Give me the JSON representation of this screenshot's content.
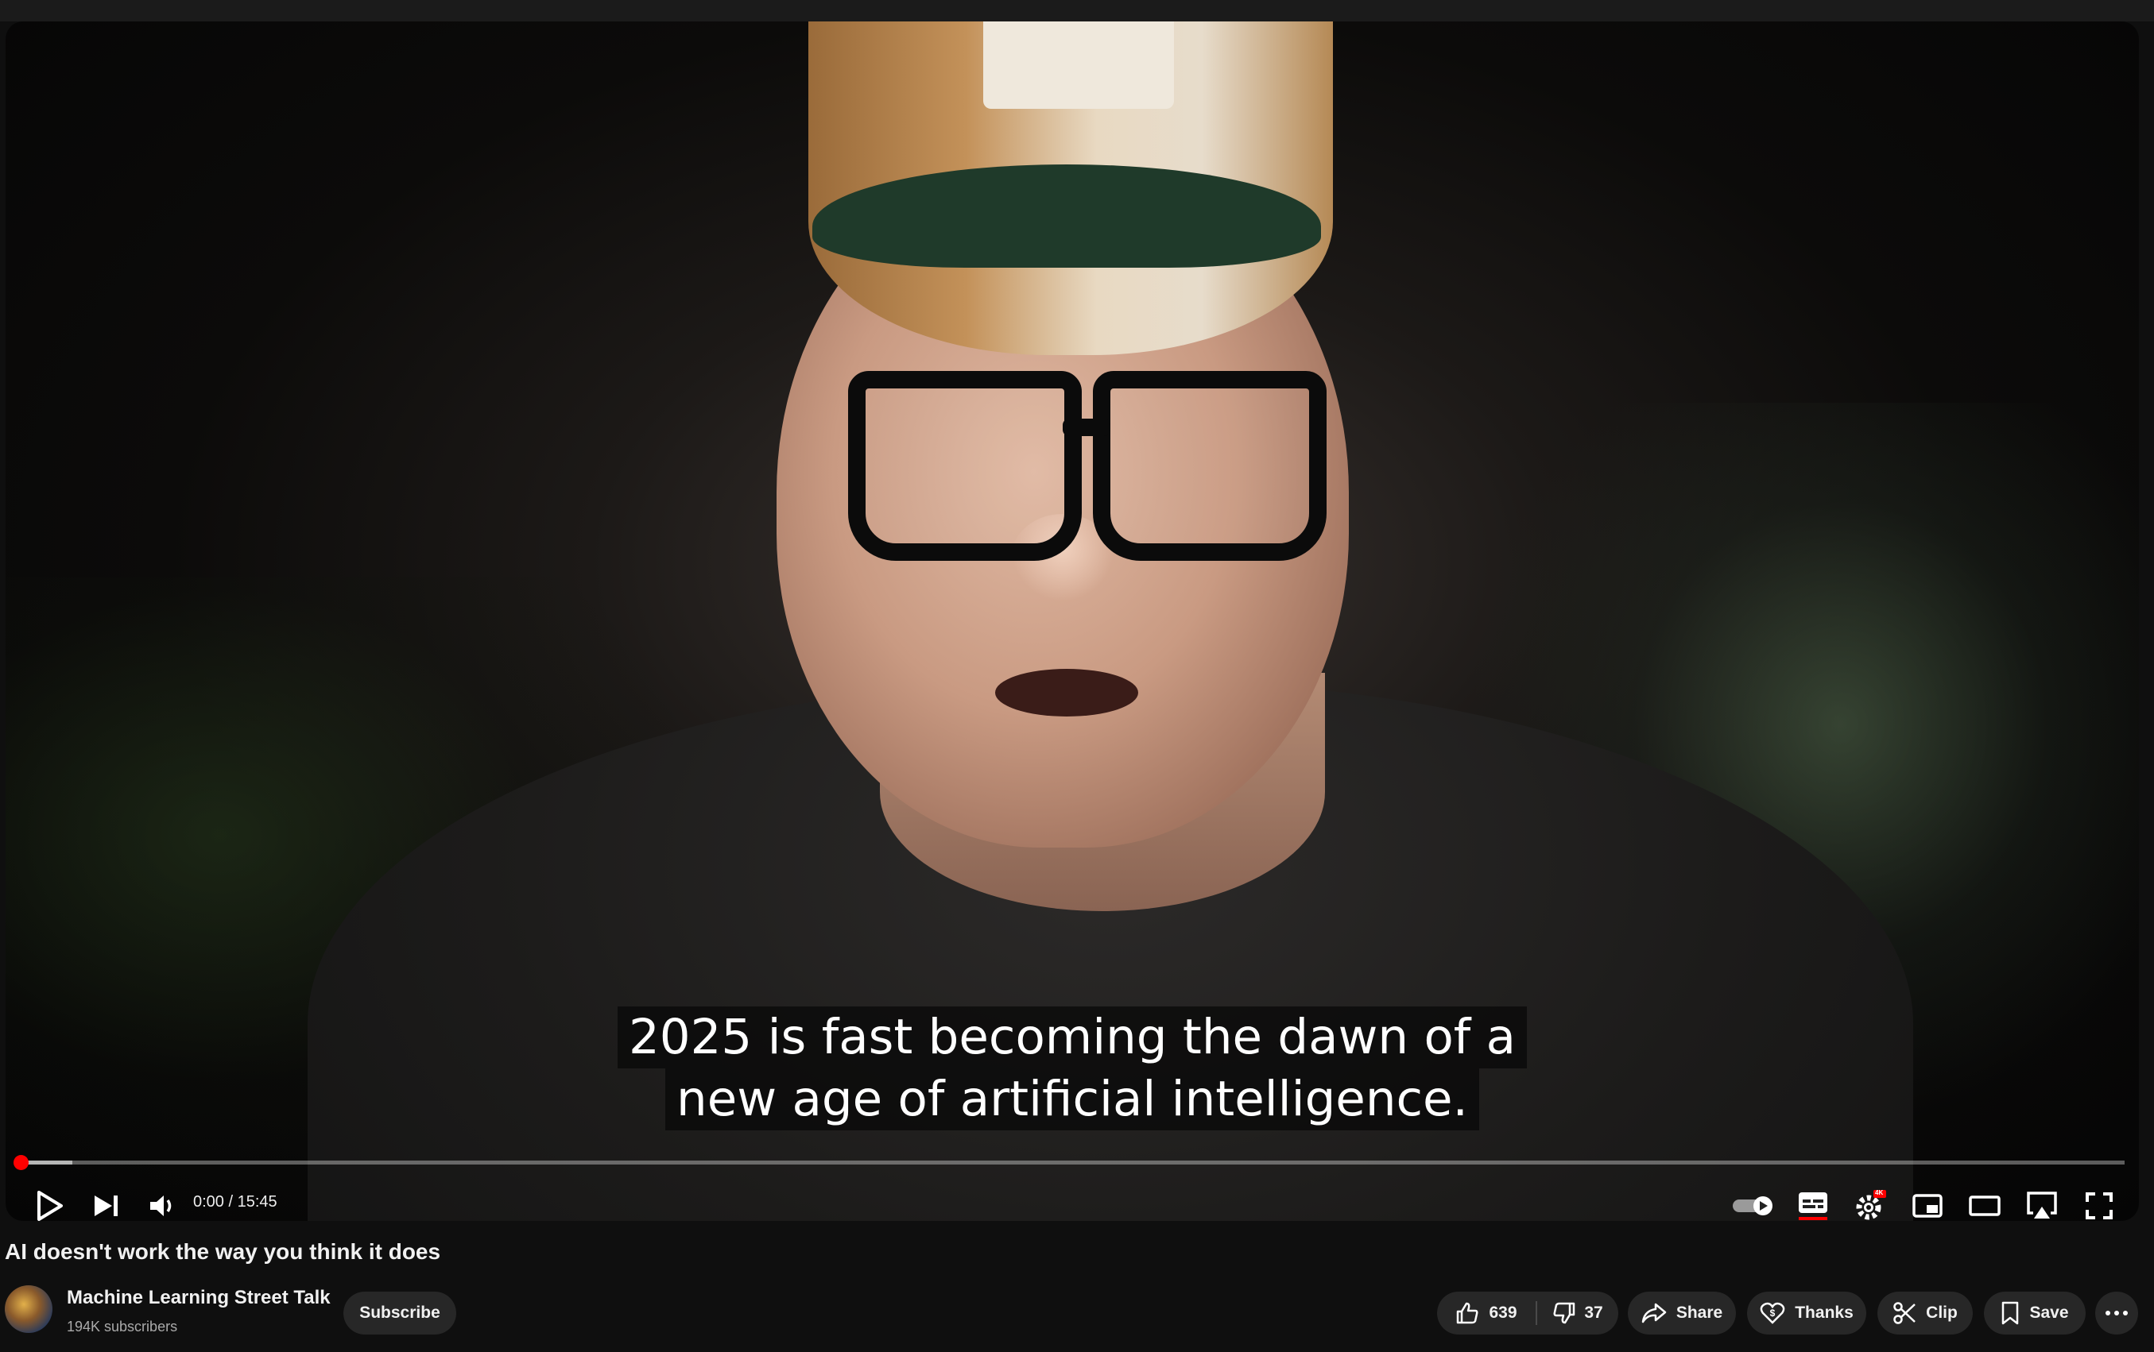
{
  "video": {
    "caption_line1": "2025 is fast becoming the dawn of a",
    "caption_line2": "new age of artificial intelligence.",
    "current_time": "0:00",
    "separator": " / ",
    "duration": "15:45",
    "progress_fraction": 0.0,
    "buffered_fraction": 0.025,
    "quality_badge": "4K"
  },
  "controls": {
    "icons": [
      "play-icon",
      "next-icon",
      "volume-icon",
      "autoplay-toggle-icon",
      "subtitles-icon",
      "settings-icon",
      "miniplayer-icon",
      "theater-mode-icon",
      "airplay-icon",
      "fullscreen-icon"
    ]
  },
  "meta": {
    "title": "AI doesn't work the way you think it does",
    "channel_name": "Machine Learning Street Talk",
    "subscribers": "194K subscribers",
    "subscribe_label": "Subscribe"
  },
  "actions": {
    "likes": "639",
    "dislikes": "37",
    "share": "Share",
    "thanks": "Thanks",
    "clip": "Clip",
    "save": "Save"
  },
  "colors": {
    "progress": "#ff0000",
    "background": "#0f0f0f",
    "button": "#272727"
  }
}
